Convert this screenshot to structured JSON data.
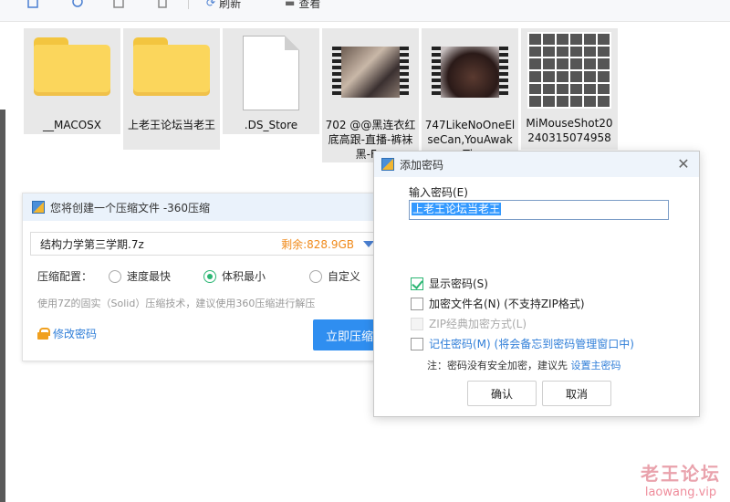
{
  "toolbar": {
    "refresh_label": "刷新",
    "view_label": "查看"
  },
  "files": [
    {
      "name": "__MACOSX",
      "kind": "folder"
    },
    {
      "name": "上老王论坛当老王",
      "kind": "folder"
    },
    {
      "name": ".DS_Store",
      "kind": "document"
    },
    {
      "name": "702 @@黑连衣红底高跟-直播-裤袜黑-F...",
      "kind": "video"
    },
    {
      "name": "747LikeNoOneElseCan,YouAwake,Th...",
      "kind": "video"
    },
    {
      "name": "MiMouseShot20240315074958",
      "kind": "image"
    }
  ],
  "compress_panel": {
    "title": "您将创建一个压缩文件 -360压缩",
    "file_name": "结构力学第三学期.7z",
    "remaining": "剩余:828.9GB",
    "config_label": "压缩配置：",
    "options": [
      "速度最快",
      "体积最小",
      "自定义"
    ],
    "selected_option": "体积最小",
    "hint": "使用7Z的固实（Solid）压缩技术，建议使用360压缩进行解压",
    "change_password": "修改密码",
    "compress_button": "立即压缩"
  },
  "password_dialog": {
    "title": "添加密码",
    "password_label": "输入密码(E)",
    "password_value": "上老王论坛当老王",
    "show_password": {
      "label": "显示密码(S)",
      "checked": true
    },
    "encrypt_filenames": {
      "label": "加密文件名(N) (不支持ZIP格式)",
      "checked": false
    },
    "zip_classic": {
      "label": "ZIP经典加密方式(L)",
      "checked": false,
      "disabled": true
    },
    "remember_password": {
      "label": "记住密码(M) (将会备忘到密码管理窗口中)",
      "checked": false
    },
    "note_prefix": "注：密码没有安全加密，建议先 ",
    "note_link": "设置主密码",
    "ok_button": "确认",
    "cancel_button": "取消"
  },
  "watermark": {
    "line1": "老王论坛",
    "line2": "laowang.vip"
  },
  "colors": {
    "accent_blue": "#2f8ef0",
    "link_blue": "#2f7ed8",
    "check_green": "#2bb673",
    "remaining_orange": "#f08a1a"
  }
}
